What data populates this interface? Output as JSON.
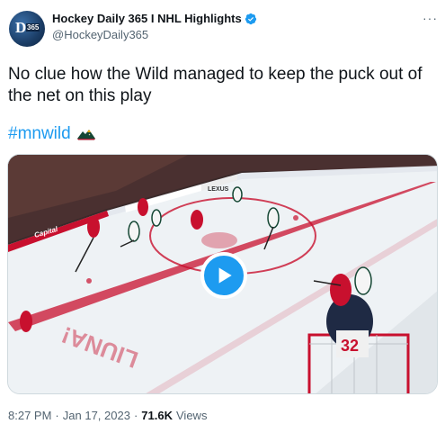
{
  "author": {
    "display_name": "Hockey Daily 365 I NHL Highlights",
    "handle": "@HockeyDaily365",
    "verified": true,
    "avatar_text": "D",
    "avatar_subtext": "365"
  },
  "more_label": "···",
  "tweet": {
    "text": "No clue how the Wild managed to keep the puck out of the net on this play",
    "hashtag": "#mnwild"
  },
  "media": {
    "type": "video",
    "rink_ads": [
      "LEXUS",
      "Capital",
      "LIUNA!",
      "32"
    ]
  },
  "meta": {
    "time": "8:27 PM",
    "separator": "·",
    "date": "Jan 17, 2023",
    "separator2": "·",
    "views_count": "71.6K",
    "views_label": "Views"
  },
  "colors": {
    "accent": "#1d9bf0",
    "text": "#0f1419",
    "secondary": "#536471",
    "border": "#cfd9de"
  }
}
